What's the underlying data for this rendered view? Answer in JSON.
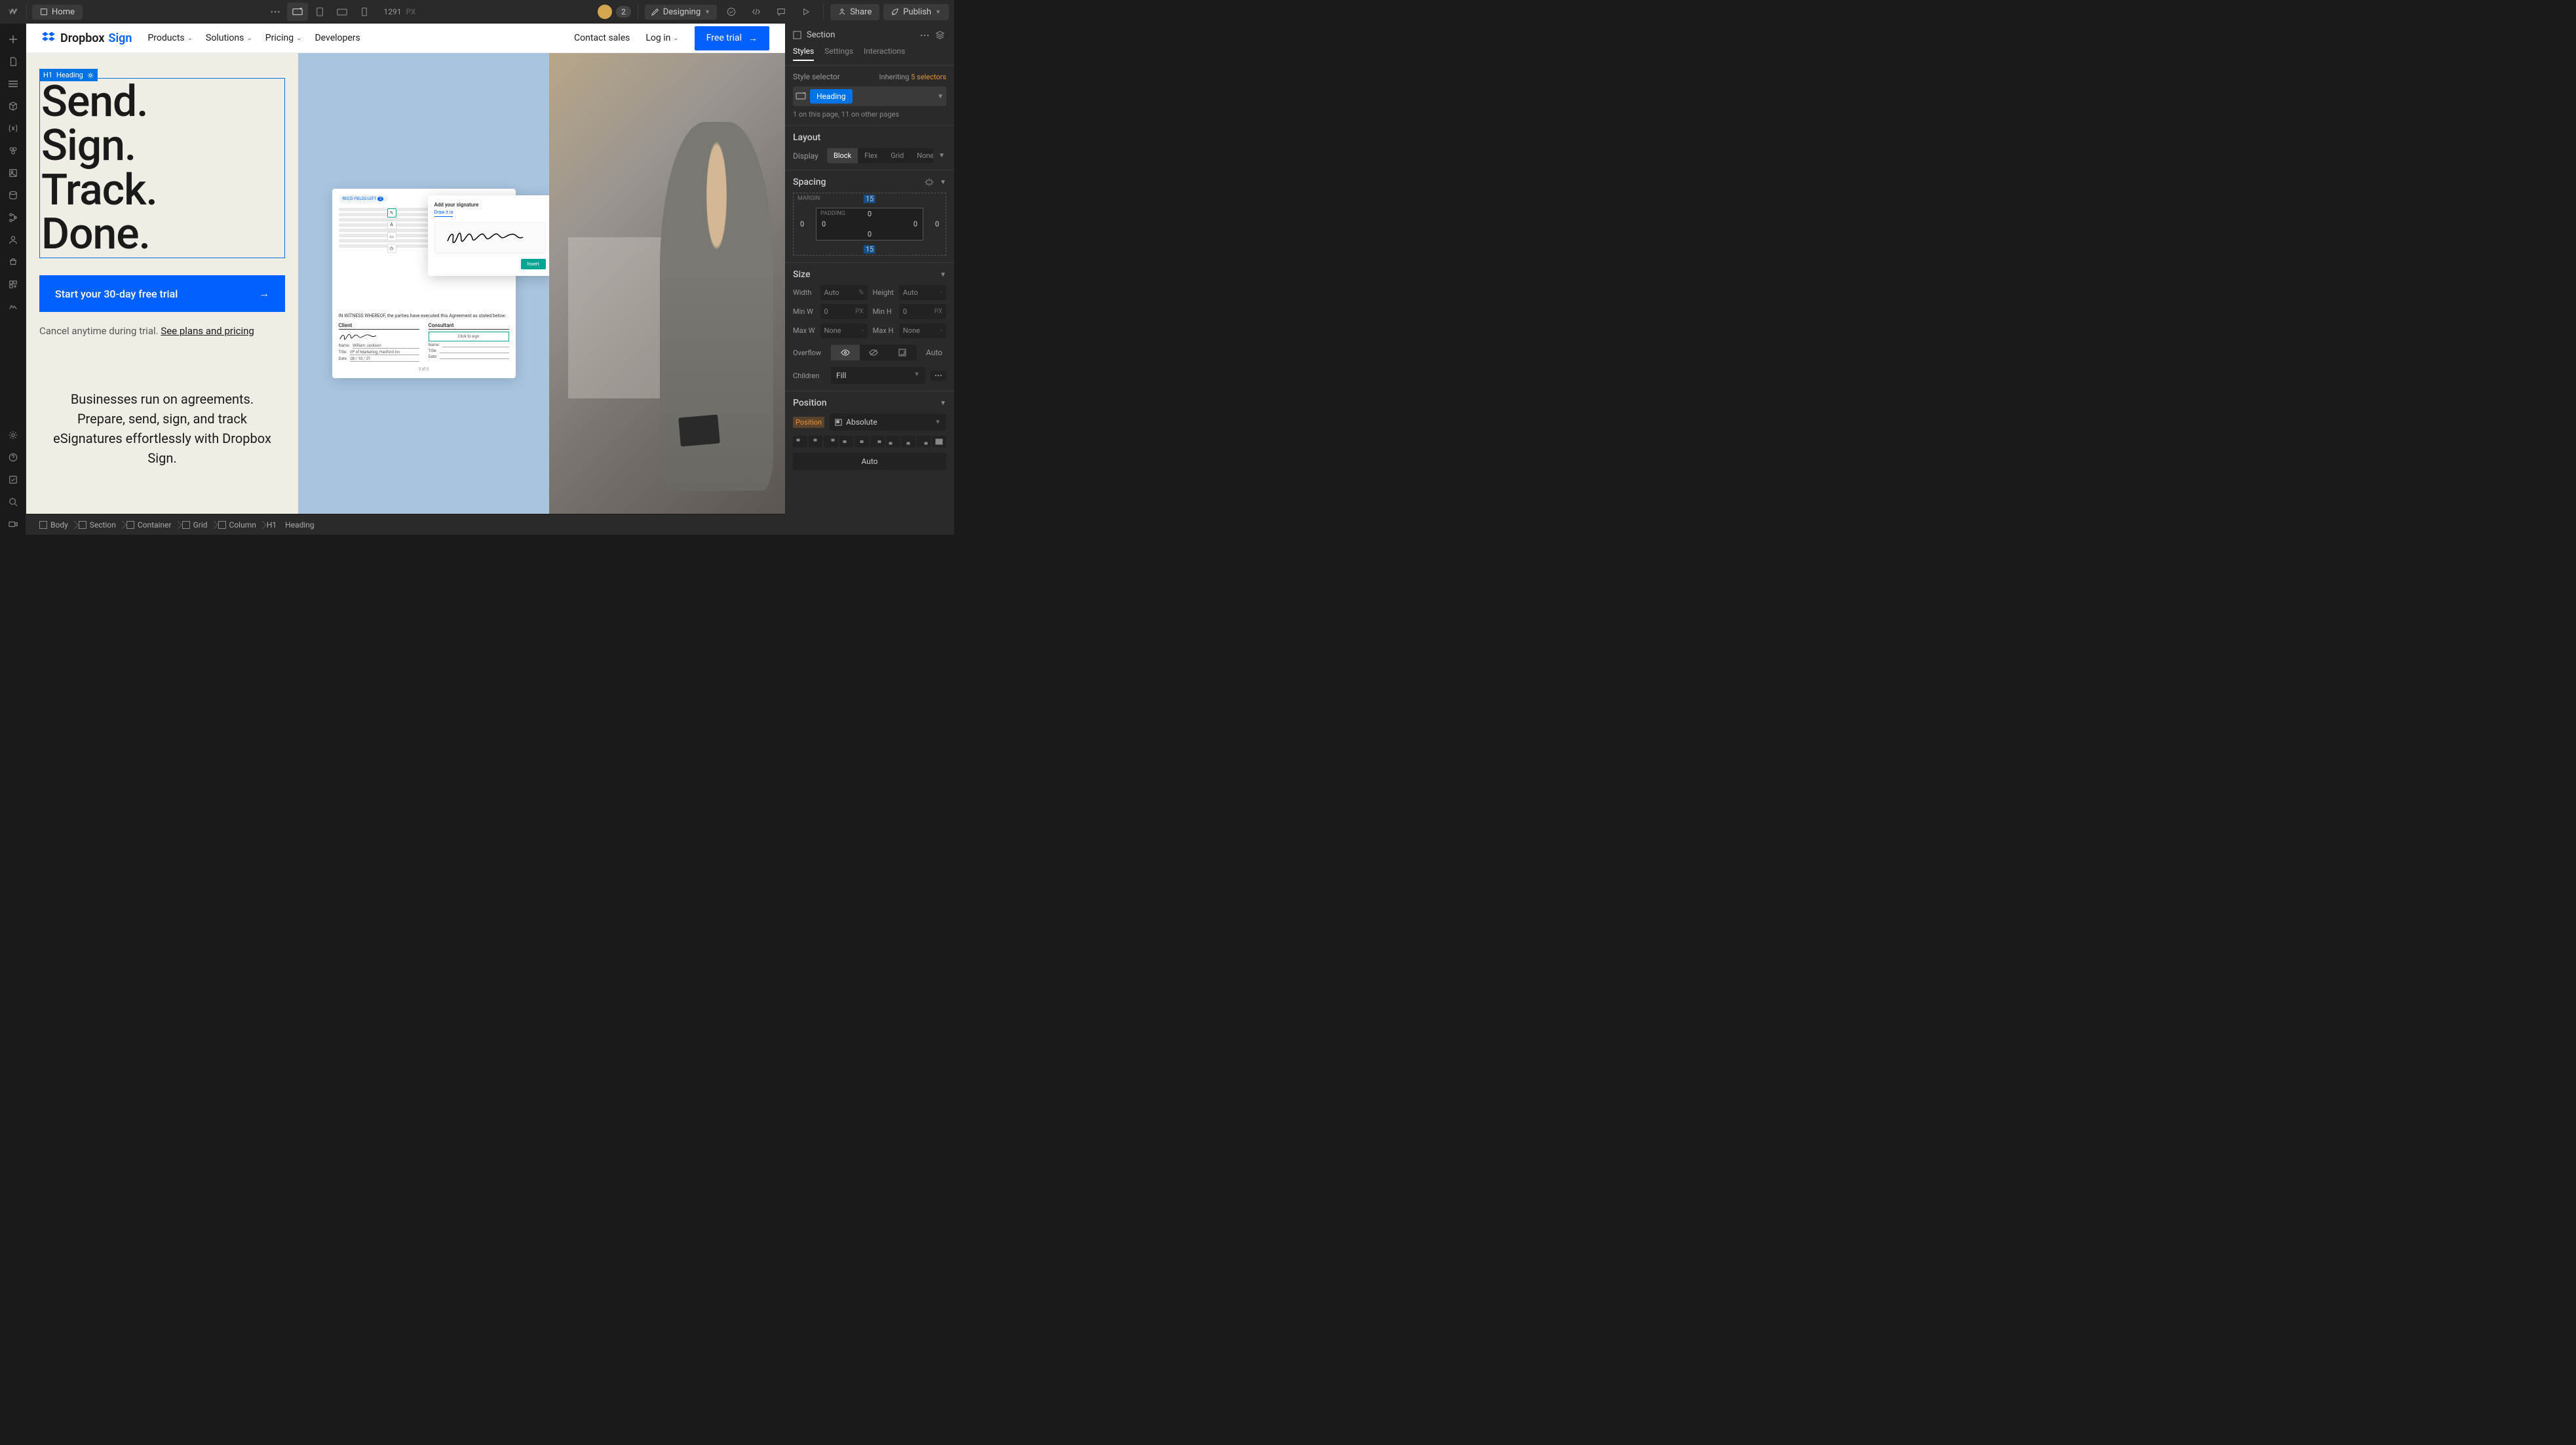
{
  "topbar": {
    "home": "Home",
    "canvas_width": "1291",
    "canvas_unit": "PX",
    "user_count": "2",
    "mode": "Designing",
    "share": "Share",
    "publish": "Publish"
  },
  "canvas": {
    "site_logo_text": "Dropbox",
    "site_logo_sign": "Sign",
    "nav": [
      {
        "label": "Products",
        "chevron": true
      },
      {
        "label": "Solutions",
        "chevron": true
      },
      {
        "label": "Pricing",
        "chevron": true
      },
      {
        "label": "Developers",
        "chevron": false
      }
    ],
    "header_contact": "Contact sales",
    "header_login": "Log in",
    "header_trial": "Free trial",
    "selected_element_type": "H1",
    "selected_element_label": "Heading",
    "heading_lines": [
      "Send.",
      "Sign.",
      "Track.",
      "Done."
    ],
    "cta": "Start your 30-day free trial",
    "cancel_prefix": "Cancel anytime during trial. ",
    "cancel_link": "See plans and pricing",
    "subhero": "Businesses run on agreements. Prepare, send, sign, and track eSignatures effortlessly with Dropbox Sign.",
    "sig_mockup": {
      "badge_prefix": "REQ'D FIELDS LEFT",
      "badge_count": "3",
      "title": "Add your signature",
      "subtitle": "Draw it in",
      "insert": "Insert",
      "witness": "IN WITNESS WHEREOF, the parties have executed this Agreement as stated below:",
      "col1": "Client",
      "col2": "Consultant",
      "click_to_sign": "Click to sign",
      "name_label": "Name:",
      "name_val": "William Jackson",
      "title_label": "Title:",
      "title_val": "VP of Marketing, Hanford Inc",
      "date_label": "Date:",
      "date_val_m": "08",
      "date_val_d": "10",
      "date_val_y": "21",
      "pager": "5 of 5"
    }
  },
  "breadcrumb": [
    {
      "icon": "box",
      "label": "Body"
    },
    {
      "icon": "box",
      "label": "Section"
    },
    {
      "icon": "box",
      "label": "Container"
    },
    {
      "icon": "grid",
      "label": "Grid"
    },
    {
      "icon": "col",
      "label": "Column"
    },
    {
      "icon": "",
      "label": "H1"
    },
    {
      "icon": "",
      "label": "Heading"
    }
  ],
  "panel": {
    "element_type": "Section",
    "tabs": [
      "Styles",
      "Settings",
      "Interactions"
    ],
    "active_tab": 0,
    "style_selector_label": "Style selector",
    "inheriting_prefix": "Inheriting ",
    "inheriting_link": "5 selectors",
    "selector_tag": "Heading",
    "selector_note": "1 on this page, 11 on other pages",
    "layout_title": "Layout",
    "display_label": "Display",
    "display_options": [
      "Block",
      "Flex",
      "Grid",
      "None"
    ],
    "display_active": 0,
    "spacing_title": "Spacing",
    "margin_label": "MARGIN",
    "padding_label": "PADDING",
    "margin": {
      "top": "15",
      "right": "0",
      "bottom": "15",
      "left": "0"
    },
    "padding": {
      "top": "0",
      "right": "0",
      "bottom": "0",
      "left": "0"
    },
    "size_title": "Size",
    "width_label": "Width",
    "width_val": "Auto",
    "width_unit": "%",
    "height_label": "Height",
    "height_val": "Auto",
    "height_unit": "-",
    "minw_label": "Min W",
    "minw_val": "0",
    "minw_unit": "PX",
    "minh_label": "Min H",
    "minh_val": "0",
    "minh_unit": "PX",
    "maxw_label": "Max W",
    "maxw_val": "None",
    "maxw_unit": "-",
    "maxh_label": "Max H",
    "maxh_val": "None",
    "maxh_unit": "-",
    "overflow_label": "Overflow",
    "overflow_auto": "Auto",
    "children_label": "Children",
    "children_val": "Fill",
    "position_title": "Position",
    "position_label": "Position",
    "position_val": "Absolute",
    "position_auto": "Auto"
  }
}
